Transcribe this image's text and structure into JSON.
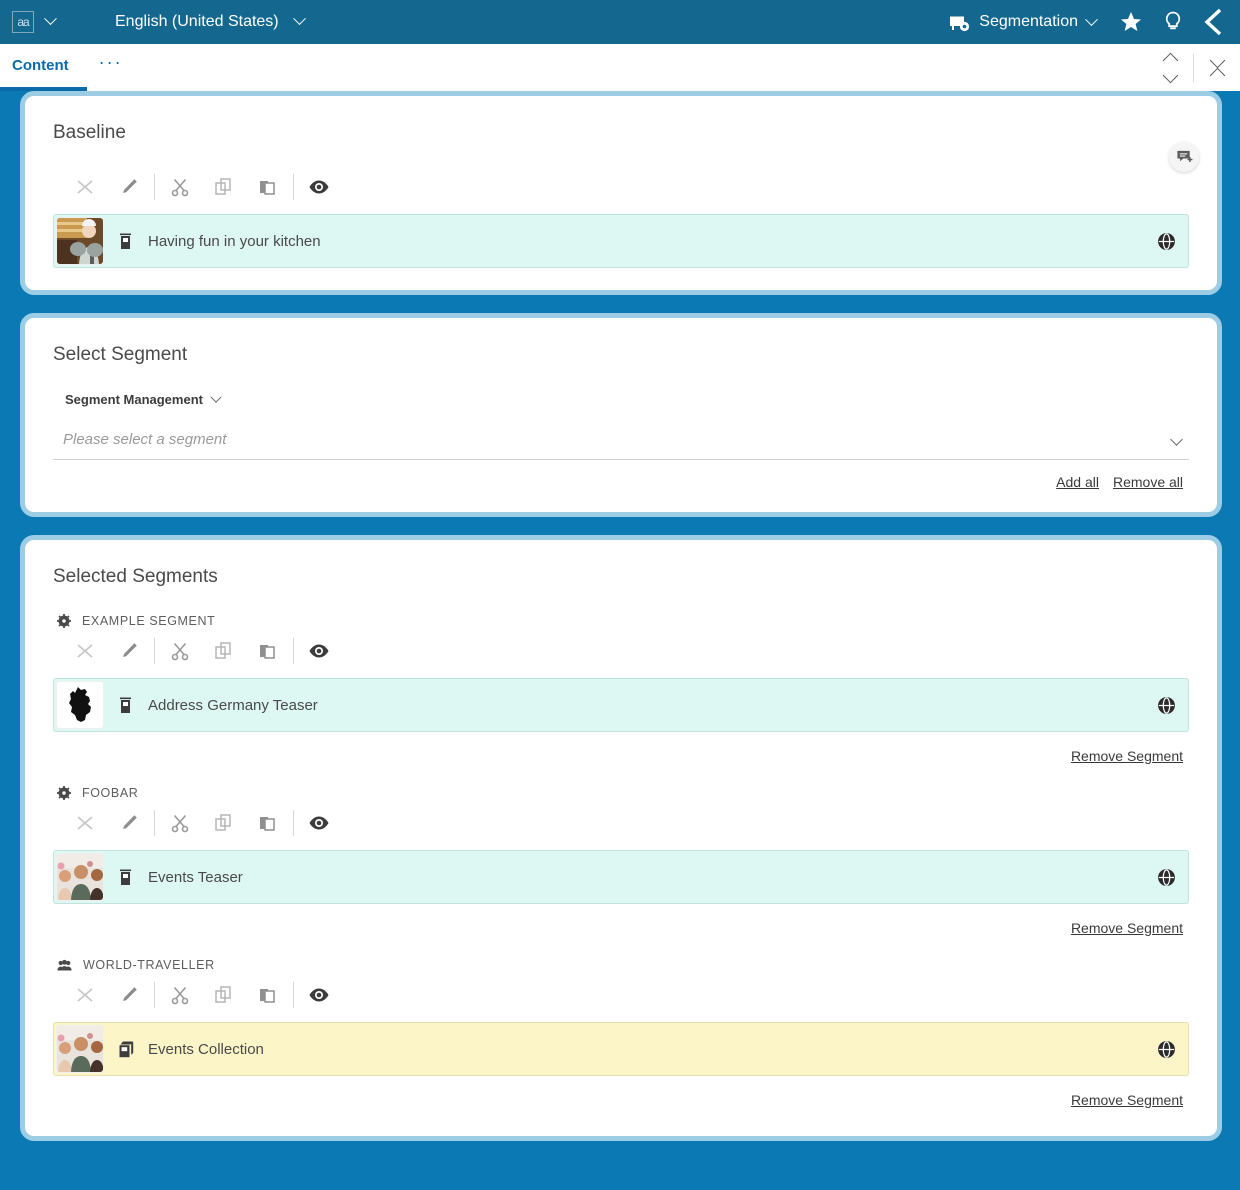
{
  "header": {
    "language_glyph": "aa",
    "language": "English (United States)",
    "app_mode": "Segmentation",
    "icons": {
      "language": "language-icon",
      "language_caret": "chevron-down-icon",
      "mode_icon": "segmentation-icon",
      "mode_caret": "chevron-down-icon",
      "favorite": "star-icon",
      "hint": "lightbulb-icon",
      "collapse": "chevron-left-icon"
    }
  },
  "tabs": {
    "items": [
      {
        "label": "Content",
        "active": true
      }
    ],
    "overflow_label": "···",
    "right_controls": [
      {
        "name": "expand-collapse-button"
      },
      {
        "name": "collapse-all-button"
      }
    ]
  },
  "toolbar": {
    "buttons": [
      {
        "name": "remove-icon",
        "label": "Remove"
      },
      {
        "name": "edit-pencil-icon",
        "label": "Edit"
      },
      {
        "name": "cut-scissors-icon",
        "label": "Cut"
      },
      {
        "name": "copy-icon",
        "label": "Copy"
      },
      {
        "name": "paste-icon",
        "label": "Paste"
      },
      {
        "name": "preview-eye-icon",
        "label": "Preview"
      }
    ]
  },
  "baseline": {
    "title": "Baseline",
    "comment_button": "add-comment-icon",
    "items": [
      {
        "label": "Having fun in your kitchen",
        "type_icon": "teaser-document-icon",
        "thumbnail": "kitchen-chef-photo",
        "locale_icon": "globe-icon",
        "highlight": "teal"
      }
    ]
  },
  "select_segment": {
    "title": "Select Segment",
    "source_label": "Segment Management",
    "source_caret": "chevron-down-icon",
    "placeholder": "Please select a segment",
    "add_all_label": "Add all",
    "remove_all_label": "Remove all"
  },
  "selected_segments": {
    "title": "Selected Segments",
    "remove_segment_label": "Remove Segment",
    "segments": [
      {
        "name": "EXAMPLE SEGMENT",
        "icon": "gear-icon",
        "item": {
          "label": "Address Germany Teaser",
          "type_icon": "teaser-document-icon",
          "thumbnail": "germany-map-silhouette",
          "locale_icon": "globe-icon",
          "highlight": "teal"
        }
      },
      {
        "name": "FOOBAR",
        "icon": "gear-icon",
        "item": {
          "label": "Events Teaser",
          "type_icon": "teaser-document-icon",
          "thumbnail": "friends-crowd-photo",
          "locale_icon": "globe-icon",
          "highlight": "teal"
        }
      },
      {
        "name": "WORLD-TRAVELLER",
        "icon": "user-group-icon",
        "item": {
          "label": "Events Collection",
          "type_icon": "collection-stack-icon",
          "thumbnail": "friends-crowd-photo",
          "locale_icon": "globe-icon",
          "highlight": "yellow"
        }
      }
    ]
  },
  "colors": {
    "app_background": "#0b79b4",
    "header_background": "#14688f",
    "panel_border": "#9ccde4",
    "tab_accent": "#0a6ba8",
    "row_teal": "#ddf7f2",
    "row_yellow": "#fbf5c8"
  }
}
